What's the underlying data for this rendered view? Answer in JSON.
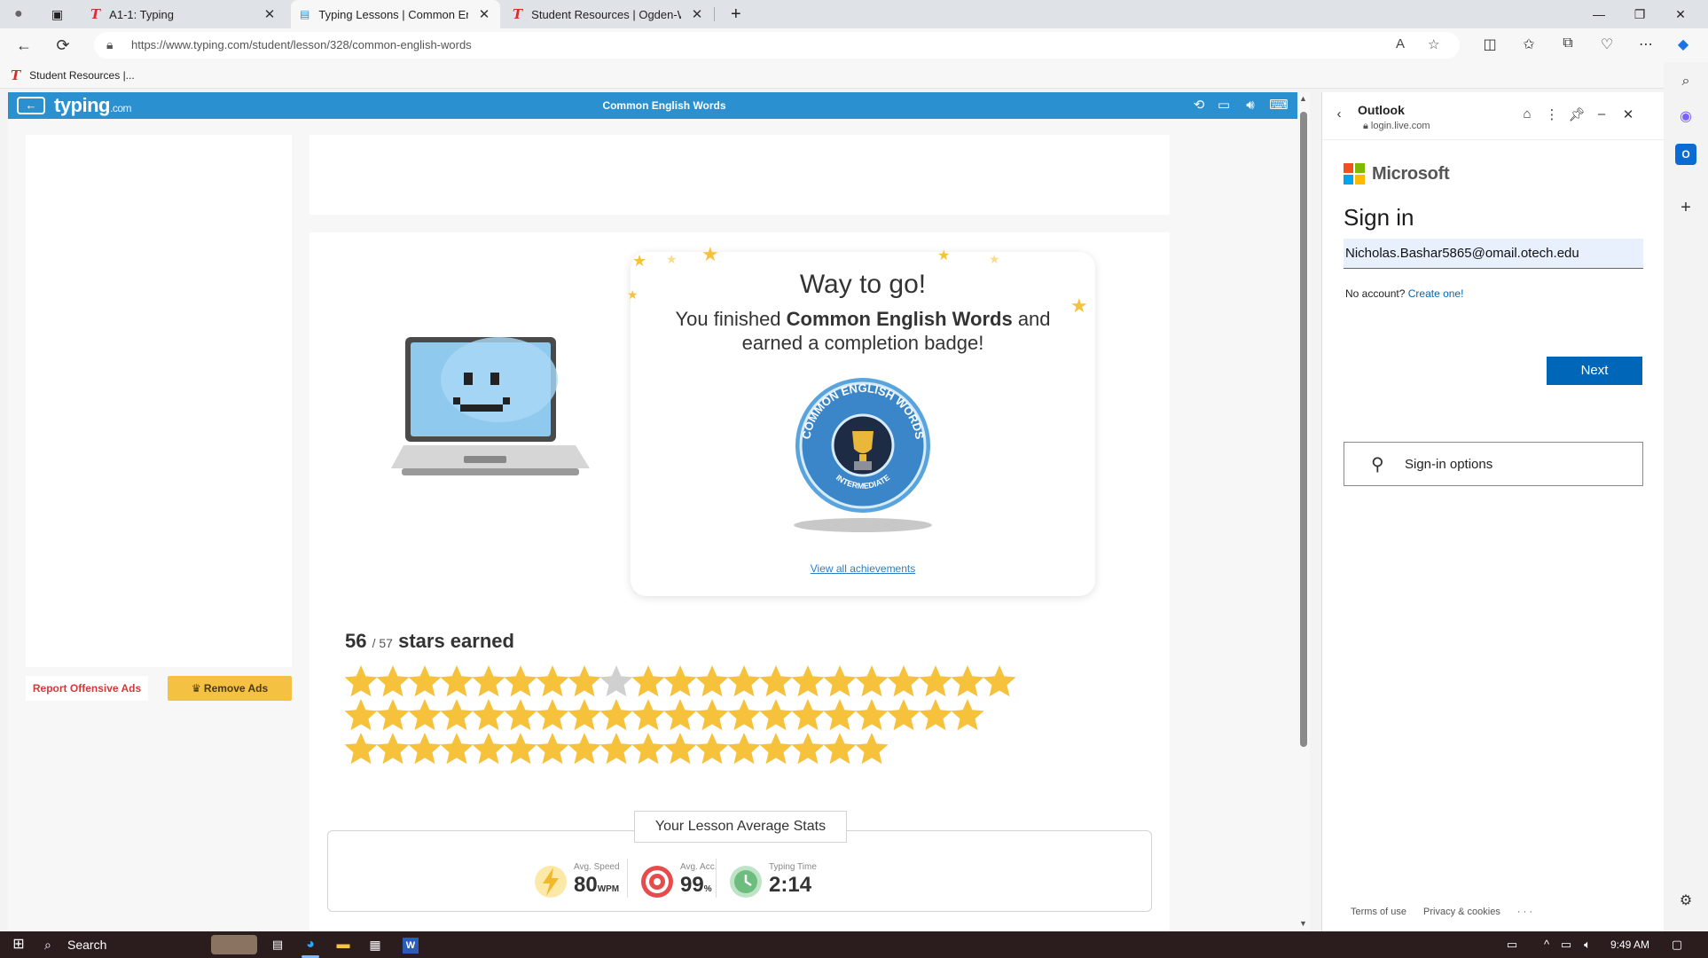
{
  "browser": {
    "tabs": [
      {
        "label": "A1-1: Typing",
        "icon": "typing-t-logo"
      },
      {
        "label": "Typing Lessons | Common Englis",
        "icon": "typing-page-icon"
      },
      {
        "label": "Student Resources | Ogden-Web",
        "icon": "typing-t-logo"
      }
    ],
    "url": "https://www.typing.com/student/lesson/328/common-english-words",
    "favorite": "Student Resources |..."
  },
  "page": {
    "logo": "typing",
    "logo_suffix": ".com",
    "title": "Common English Words",
    "report_ads": "Report Offensive Ads",
    "remove_ads": "Remove Ads",
    "headline": "Way to go!",
    "message_pre": "You finished ",
    "message_bold": "Common English Words",
    "message_post": " and earned a completion badge!",
    "badge_text": "COMMON ENGLISH WORDS",
    "badge_level": "INTERMEDIATE",
    "view_all": "View all achievements",
    "stars_earned": "56",
    "stars_total": "/ 57",
    "stars_suffix": "stars earned",
    "stats_title": "Your Lesson Average Stats",
    "stats": [
      {
        "label": "Avg. Speed",
        "value": "80",
        "unit": "WPM"
      },
      {
        "label": "Avg. Acc.",
        "value": "99",
        "unit": "%"
      },
      {
        "label": "Typing Time",
        "value": "2:14",
        "unit": ""
      }
    ]
  },
  "stars": {
    "rows": [
      21,
      20,
      17
    ],
    "grey_index": 8,
    "color_filled": "#f6c23c",
    "color_empty": "#d0d0d0"
  },
  "outlook": {
    "title": "Outlook",
    "url": "login.live.com",
    "brand": "Microsoft",
    "heading": "Sign in",
    "email": "Nicholas.Bashar5865@omail.otech.edu",
    "no_account": "No account?",
    "create": "Create one!",
    "next": "Next",
    "options": "Sign-in options",
    "footer": [
      "Terms of use",
      "Privacy & cookies",
      "· · ·"
    ]
  },
  "taskbar": {
    "search": "Search",
    "time": "9:49 AM"
  },
  "colors": {
    "accent": "#2a90d0",
    "ms_blue": "#0067b8",
    "star": "#f6c23c"
  }
}
